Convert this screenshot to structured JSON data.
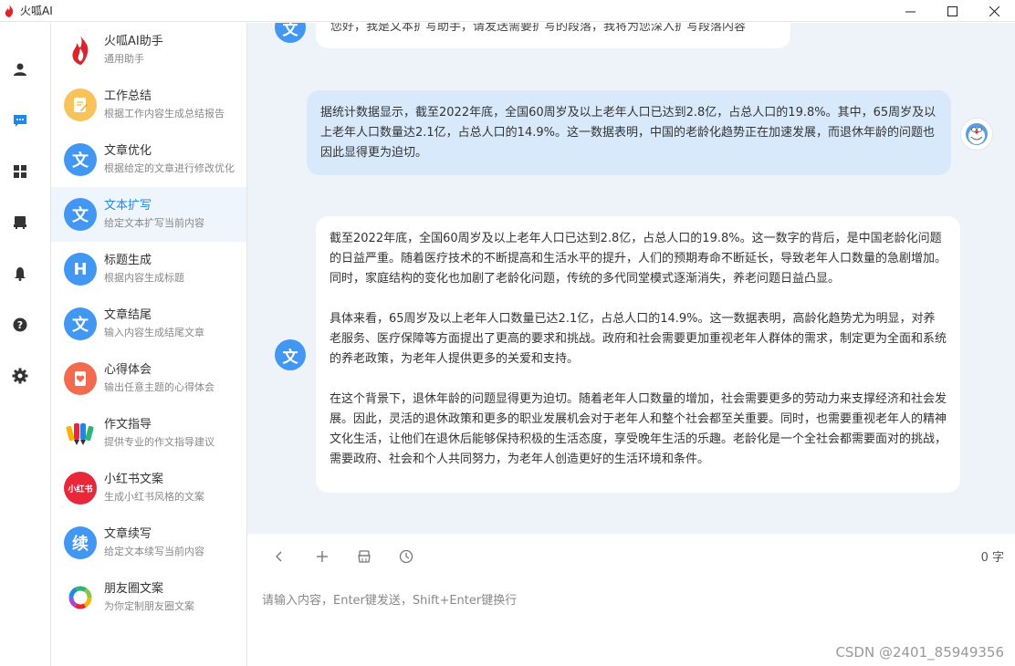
{
  "window": {
    "title": "火呱AI"
  },
  "sidebar": {
    "items": [
      {
        "title": "火呱AI助手",
        "subtitle": "通用助手",
        "avatar_text": "",
        "color": "#ffffff"
      },
      {
        "title": "工作总结",
        "subtitle": "根据工作内容生成总结报告",
        "avatar_text": "",
        "color": "#f8c35a"
      },
      {
        "title": "文章优化",
        "subtitle": "根据给定的文章进行修改优化",
        "avatar_text": "文",
        "color": "#4297f2"
      },
      {
        "title": "文本扩写",
        "subtitle": "给定文本扩写当前内容",
        "avatar_text": "文",
        "color": "#4297f2"
      },
      {
        "title": "标题生成",
        "subtitle": "根据内容生成标题",
        "avatar_text": "H",
        "color": "#4297f2"
      },
      {
        "title": "文章结尾",
        "subtitle": "输入内容生成结尾文章",
        "avatar_text": "文",
        "color": "#4297f2"
      },
      {
        "title": "心得体会",
        "subtitle": "输出任意主题的心得体会",
        "avatar_text": "",
        "color": "#f26b4f"
      },
      {
        "title": "作文指导",
        "subtitle": "提供专业的作文指导建议",
        "avatar_text": "",
        "color": "#ffffff"
      },
      {
        "title": "小红书文案",
        "subtitle": "生成小红书风格的文案",
        "avatar_text": "小红书",
        "color": "#e8273b"
      },
      {
        "title": "文章续写",
        "subtitle": "给定文本续写当前内容",
        "avatar_text": "续",
        "color": "#4297f2"
      },
      {
        "title": "朋友圈文案",
        "subtitle": "为你定制朋友圈文案",
        "avatar_text": "",
        "color": "#ffffff"
      }
    ]
  },
  "chat": {
    "intro": "您好，我是文本扩写助手，请发送需要扩写的段落，我将为您深入扩写段落内容",
    "user_message": "据统计数据显示，截至2022年底，全国60周岁及以上老年人口已达到2.8亿，占总人口的19.8%。其中，65周岁及以上老年人口数量达2.1亿，占总人口的14.9%。这一数据表明，中国的老龄化趋势正在加速发展，而退休年龄的问题也因此显得更为迫切。",
    "reply_paragraphs": [
      "截至2022年底，全国60周岁及以上老年人口已达到2.8亿，占总人口的19.8%。这一数字的背后，是中国老龄化问题的日益严重。随着医疗技术的不断提高和生活水平的提升，人们的预期寿命不断延长，导致老年人口数量的急剧增加。同时，家庭结构的变化也加剧了老龄化问题，传统的多代同堂模式逐渐消失，养老问题日益凸显。",
      "具体来看，65周岁及以上老年人口数量已达2.1亿，占总人口的14.9%。这一数据表明，高龄化趋势尤为明显，对养老服务、医疗保障等方面提出了更高的要求和挑战。政府和社会需要更加重视老年人群体的需求，制定更为全面和系统的养老政策，为老年人提供更多的关爱和支持。",
      "在这个背景下，退休年龄的问题显得更为迫切。随着老年人口数量的增加，社会需要更多的劳动力来支撑经济和社会发展。因此，灵活的退休政策和更多的职业发展机会对于老年人和整个社会都至关重要。同时，也需要重视老年人的精神文化生活，让他们在退休后能够保持积极的生活态度，享受晚年生活的乐趣。老龄化是一个全社会都需要面对的挑战，需要政府、社会和个人共同努力，为老年人创造更好的生活环境和条件。"
    ],
    "bot_avatar_text": "文"
  },
  "composer": {
    "char_count": "0 字",
    "placeholder": "请输入内容，Enter键发送，Shift+Enter键换行"
  },
  "watermark": "CSDN @2401_85949356"
}
